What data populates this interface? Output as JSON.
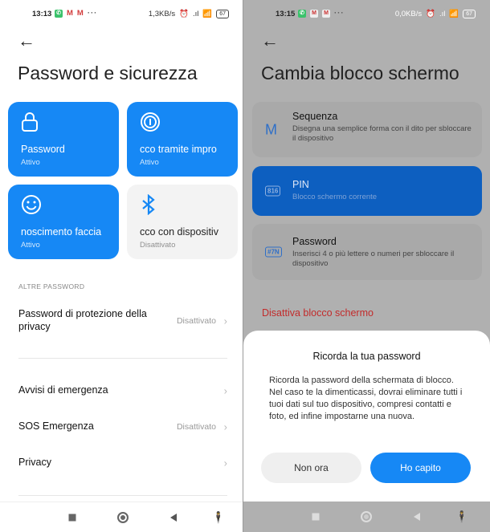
{
  "left": {
    "status": {
      "time": "13:13",
      "net_speed": "1,3KB/s",
      "battery": "67"
    },
    "title": "Password e sicurezza",
    "tiles": [
      {
        "icon": "lock-icon",
        "label": "Password",
        "state": "Attivo",
        "active": true
      },
      {
        "icon": "fingerprint-icon",
        "label": "cco tramite impro",
        "state": "Attivo",
        "active": true
      },
      {
        "icon": "face-icon",
        "label": "noscimento faccia",
        "state": "Attivo",
        "active": true
      },
      {
        "icon": "bluetooth-icon",
        "label": "cco con dispositiv",
        "state": "Disattivato",
        "active": false
      }
    ],
    "section_header": "ALTRE PASSWORD",
    "rows": [
      {
        "label": "Password di protezione della privacy",
        "value": "Disattivato"
      },
      {
        "label": "Avvisi di emergenza",
        "value": ""
      },
      {
        "label": "SOS Emergenza",
        "value": "Disattivato"
      },
      {
        "label": "Privacy",
        "value": ""
      }
    ]
  },
  "right": {
    "status": {
      "time": "13:15",
      "net_speed": "0,0KB/s",
      "battery": "67"
    },
    "title": "Cambia blocco schermo",
    "options": [
      {
        "icon": "pattern-icon",
        "icon_text": "M",
        "title": "Sequenza",
        "desc": "Disegna una semplice forma con il dito per sbloccare il dispositivo",
        "selected": false
      },
      {
        "icon": "pin-icon",
        "icon_text": "816",
        "title": "PIN",
        "desc": "Blocco schermo corrente",
        "selected": true
      },
      {
        "icon": "password-icon",
        "icon_text": "#7N",
        "title": "Password",
        "desc": "Inserisci 4 o più lettere o numeri per sbloccare il dispositivo",
        "selected": false
      }
    ],
    "disable_label": "Disattiva blocco schermo",
    "dialog": {
      "title": "Ricorda la tua password",
      "body": "Ricorda la password della schermata di blocco. Nel caso te la dimenticassi, dovrai eliminare tutti i tuoi dati sul tuo dispositivo, compresi contatti e foto, ed infine impostarne una nuova.",
      "secondary": "Non ora",
      "primary": "Ho capito"
    }
  },
  "icons": {
    "back": "←",
    "chevron": "›",
    "dots": "···",
    "alarm": "⏰",
    "wifi": "≋",
    "signal": ".ıl",
    "accessibility": "🚹"
  }
}
